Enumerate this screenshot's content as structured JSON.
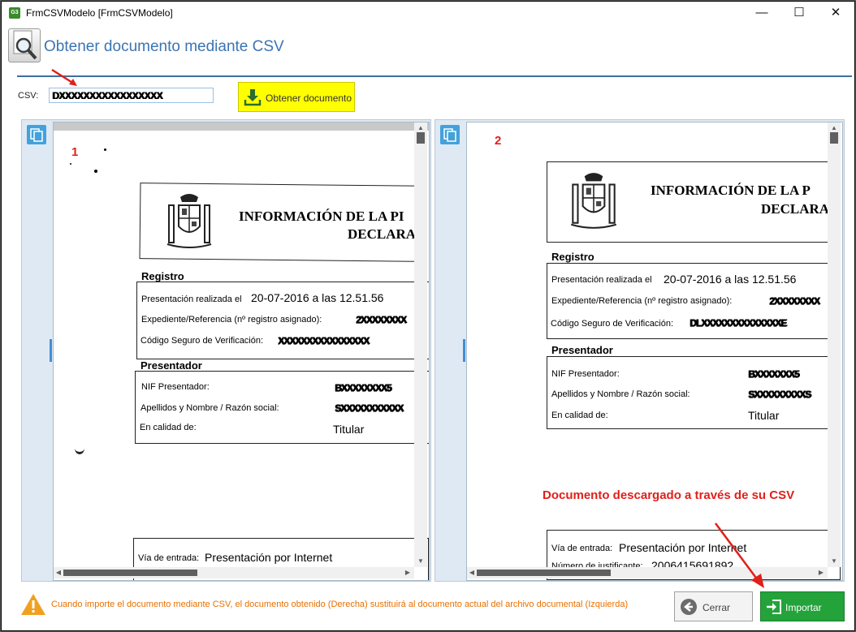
{
  "window": {
    "app_icon_text": "G3",
    "title": "FrmCSVModelo [FrmCSVModelo]",
    "minimize": "—",
    "maximize": "☐",
    "close": "✕"
  },
  "header": {
    "title": "Obtener documento mediante CSV"
  },
  "csv": {
    "label": "CSV:",
    "value": "DXXXXXXXXXXXXXXXXX"
  },
  "obtain_button": {
    "label": "Obtener documento"
  },
  "left_doc": {
    "number": "1",
    "title_line1": "INFORMACIÓN DE LA PI",
    "title_line2": "DECLARA",
    "section_registro": "Registro",
    "presentacion_label": "Presentación realizada el",
    "presentacion_value": "20-07-2016 a las 12.51.56",
    "expediente_label": "Expediente/Referencia (nº registro asignado):",
    "expediente_value": "2XXXXXXXX",
    "codigo_label": "Código Seguro de Verificación:",
    "codigo_value": "XXXXXXXXXXXXXXXX",
    "section_presentador": "Presentador",
    "nif_label": "NIF Presentador:",
    "nif_value": "BXXXXXXXX5",
    "apellidos_label": "Apellidos y Nombre / Razón social:",
    "apellidos_value": "SXXXXXXXXXXX",
    "calidad_label": "En calidad de:",
    "calidad_value": "Titular",
    "via_label": "Vía de entrada:",
    "via_value": "Presentación por Internet"
  },
  "right_doc": {
    "number": "2",
    "title_line1": "INFORMACIÓN DE LA P",
    "title_line2": "DECLARA",
    "section_registro": "Registro",
    "presentacion_label": "Presentación realizada el",
    "presentacion_value": "20-07-2016 a las 12.51.56",
    "expediente_label": "Expediente/Referencia (nº registro asignado):",
    "expediente_value": "2XXXXXXXX",
    "codigo_label": "Código Seguro de Verificación:",
    "codigo_value": "DLXXXXXXXXXXXXXXE",
    "section_presentador": "Presentador",
    "nif_label": "NIF Presentador:",
    "nif_value": "BXXXXXXX5",
    "apellidos_label": "Apellidos y Nombre / Razón social:",
    "apellidos_value": "SXXXXXXXXXS",
    "calidad_label": "En calidad de:",
    "calidad_value": "Titular",
    "via_label": "Vía de entrada:",
    "via_value": "Presentación por Internet",
    "justificante_label": "Número de justificante:",
    "justificante_value": "2006415691892"
  },
  "annotation": "Documento descargado a través de su CSV",
  "footer": {
    "warning": "Cuando importe el documento mediante CSV, el documento obtenido (Derecha) sustituirá al documento actual del archivo documental (Izquierda)",
    "cancel_label": "Cerrar",
    "import_label": "Importar"
  },
  "colors": {
    "accent": "#3b74b2",
    "obtain_button": "#ffff00",
    "import_button": "#23a33a",
    "annotation": "#e0201a",
    "warning_text": "#e87000"
  }
}
